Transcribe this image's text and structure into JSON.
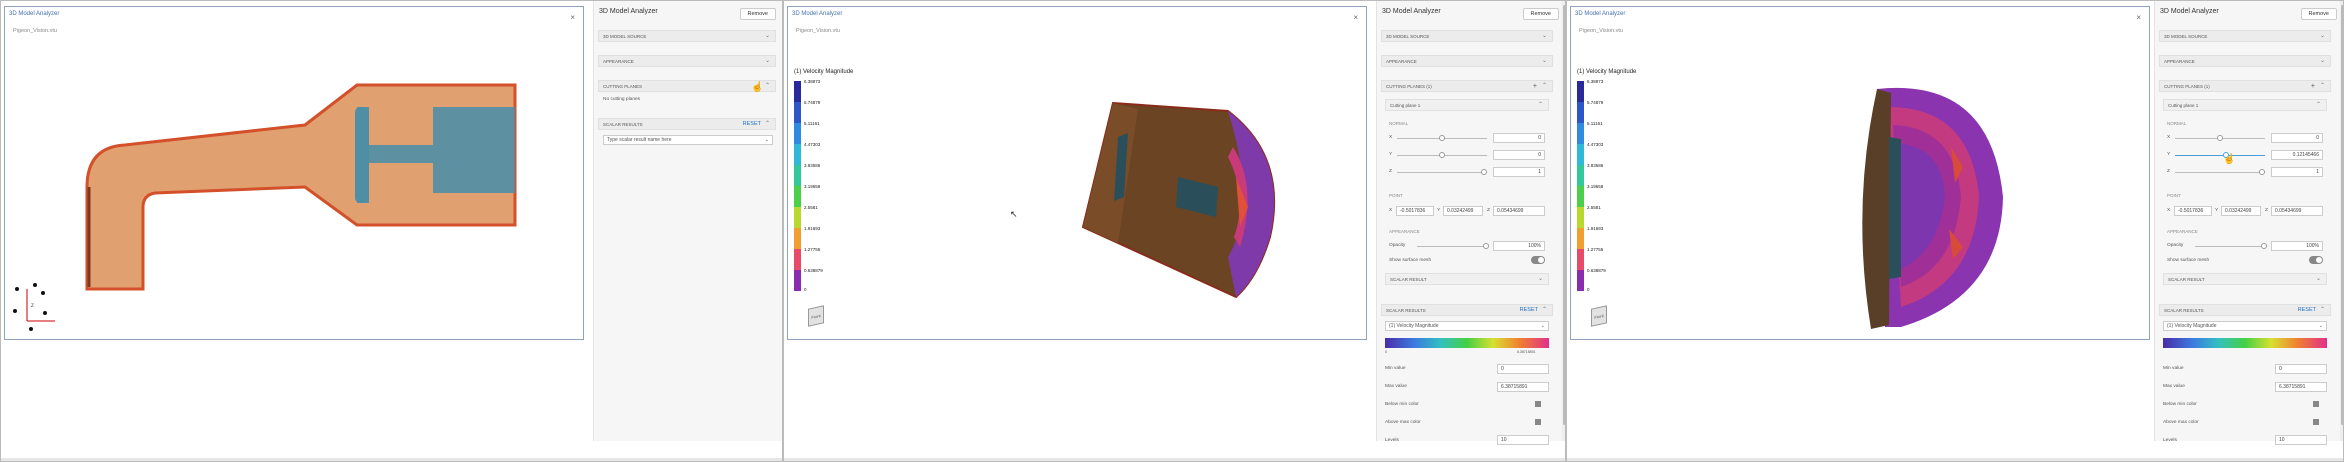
{
  "app_title": "3D Model Analyzer",
  "file_name": "Pigeon_Vision.vtu",
  "close_glyph": "×",
  "remove_label": "Remove",
  "sections": {
    "model_source": "3D MODEL SOURCE",
    "appearance": "APPEARANCE",
    "cutting_planes": "CUTTING PLANES",
    "cutting_planes_count": "CUTTING PLANES (1)",
    "scalar_results": "SCALAR RESULTS"
  },
  "no_planes_text": "No cutting planes",
  "reset_label": "Reset",
  "scalar_placeholder": "Type scalar result name here",
  "cutting_plane_name": "Cutting plane 1",
  "normal_label": "NORMAL",
  "point_label": "POINT",
  "appearance_sub": "APPEARANCE",
  "axes": [
    "X",
    "Y",
    "Z"
  ],
  "normal_values_p2": [
    "0",
    "0",
    "1"
  ],
  "normal_values_p3": [
    "0",
    "0.12145466",
    "1"
  ],
  "point_values": [
    "-0.5017836",
    "0.03242499",
    "0.05434699"
  ],
  "opacity_label": "Opacity",
  "opacity_value": "100%",
  "show_surface_mesh": "Show surface mesh",
  "scalar_result_sub": "SCALAR RESULT",
  "scalar_selected": "(1) Velocity Magnitude",
  "min_label": "Min value",
  "min_value": "0",
  "max_label": "Max value",
  "max_value": "6.38715891",
  "below_min_label": "Below min color",
  "above_max_label": "Above max color",
  "levels_label": "Levels",
  "levels_value": "10",
  "gradient_ticks": [
    "0",
    "6.38715891"
  ],
  "colorbar": {
    "title": "(1) Velocity Magnitude",
    "ticks": [
      "6.38873",
      "5.74879",
      "5.11161",
      "4.47303",
      "3.83586",
      "3.19658",
      "2.5581",
      "1.91693",
      "1.27755",
      "0.638879",
      "0"
    ]
  },
  "colors": {
    "accent": "#4a9fd9",
    "pipe_fill": "#e0a070",
    "pipe_edge": "#d4502a",
    "inner_blue": "#4f8fa6"
  }
}
